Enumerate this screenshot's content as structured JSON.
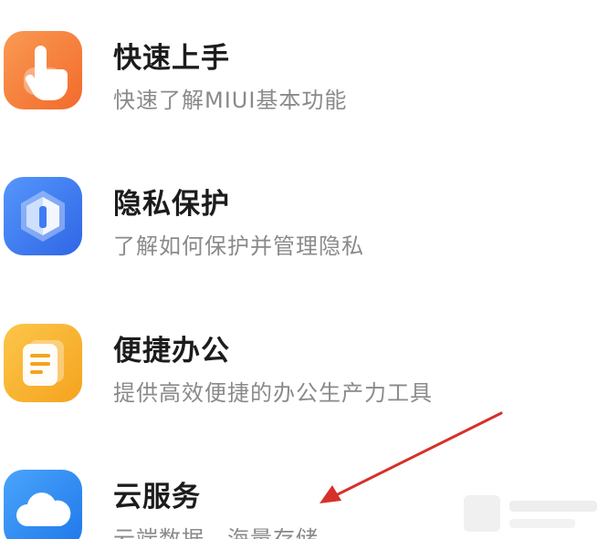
{
  "items": [
    {
      "title": "快速上手",
      "subtitle": "快速了解MIUI基本功能",
      "icon": "tap-hand-icon",
      "color": "#f7813e"
    },
    {
      "title": "隐私保护",
      "subtitle": "了解如何保护并管理隐私",
      "icon": "privacy-shield-icon",
      "color": "#3f7cf3"
    },
    {
      "title": "便捷办公",
      "subtitle": "提供高效便捷的办公生产力工具",
      "icon": "office-note-icon",
      "color": "#f7b62e"
    },
    {
      "title": "云服务",
      "subtitle": "云端数据，海量存储",
      "icon": "cloud-icon",
      "color": "#2f8ef5"
    }
  ],
  "annotation": {
    "arrow_color": "#d6302a"
  }
}
